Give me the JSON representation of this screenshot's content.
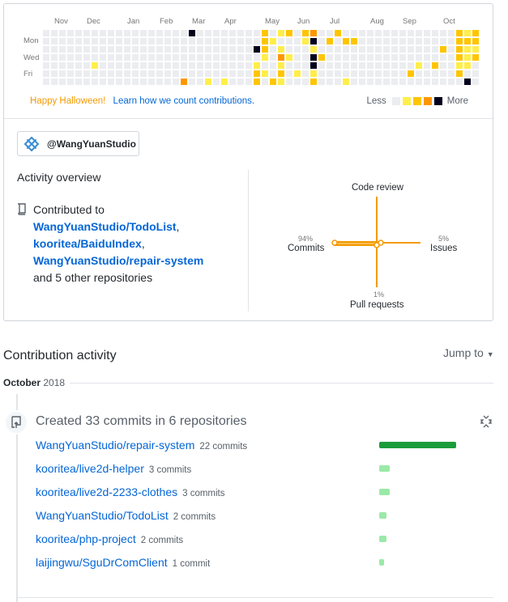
{
  "graph": {
    "months": [
      "Nov",
      "Dec",
      "Jan",
      "Feb",
      "Mar",
      "Apr",
      "May",
      "Jun",
      "Jul",
      "Aug",
      "Sep",
      "Oct"
    ],
    "days": [
      "Mon",
      "Wed",
      "Fri"
    ],
    "halloween_text": "Happy Halloween!",
    "learn_link": "Learn how we count contributions.",
    "legend_less": "Less",
    "legend_more": "More",
    "colors": [
      "#ebedf0",
      "#ffee4a",
      "#ffc501",
      "#fe9600",
      "#03001c"
    ]
  },
  "org_button": {
    "label": "@WangYuanStudio"
  },
  "activity": {
    "title": "Activity overview",
    "contributed_to": "Contributed to",
    "repos": [
      "WangYuanStudio/TodoList",
      "kooritea/BaiduIndex",
      "WangYuanStudio/repair-system"
    ],
    "others": "and 5 other repositories"
  },
  "radar": {
    "code_review": "Code review",
    "commits": "Commits",
    "commits_pct": "94%",
    "issues": "Issues",
    "issues_pct": "5%",
    "pull_requests": "Pull requests",
    "pr_pct": "1%",
    "color": "#f49a00"
  },
  "contribution_activity": {
    "title": "Contribution activity",
    "jump_to": "Jump to",
    "month": "October",
    "year": "2018",
    "created_summary": "Created 33 commits in 6 repositories",
    "rows": [
      {
        "repo": "WangYuanStudio/repair-system",
        "count": "22 commits",
        "ratio": 1.0
      },
      {
        "repo": "kooritea/live2d-helper",
        "count": "3 commits",
        "ratio": 0.14
      },
      {
        "repo": "kooritea/live2d-2233-clothes",
        "count": "3 commits",
        "ratio": 0.14
      },
      {
        "repo": "WangYuanStudio/TodoList",
        "count": "2 commits",
        "ratio": 0.09
      },
      {
        "repo": "kooritea/php-project",
        "count": "2 commits",
        "ratio": 0.09
      },
      {
        "repo": "laijingwu/SguDrComClient",
        "count": "1 commit",
        "ratio": 0.05
      }
    ],
    "bar_color_full": "#2cbe4e",
    "bar_color_light": "#9be9a8",
    "bar_color_main": "#1a9c3b"
  }
}
